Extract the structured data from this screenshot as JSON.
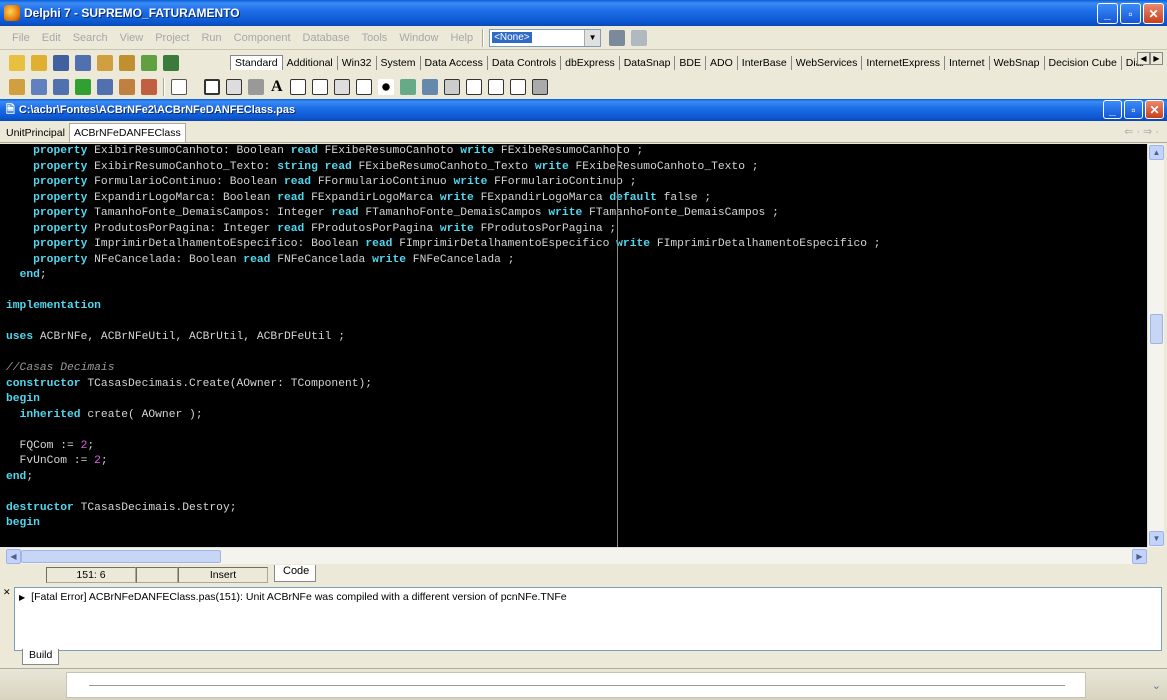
{
  "app": {
    "title": "Delphi 7 - SUPREMO_FATURAMENTO",
    "menu": [
      "File",
      "Edit",
      "Search",
      "View",
      "Project",
      "Run",
      "Component",
      "Database",
      "Tools",
      "Window",
      "Help"
    ],
    "config_combo": "<None>"
  },
  "palette_tabs": [
    "Standard",
    "Additional",
    "Win32",
    "System",
    "Data Access",
    "Data Controls",
    "dbExpress",
    "DataSnap",
    "BDE",
    "ADO",
    "InterBase",
    "WebServices",
    "InternetExpress",
    "Internet",
    "WebSnap",
    "Decision Cube",
    "Dial"
  ],
  "editor": {
    "file_path": "C:\\acbr\\Fontes\\ACBrNFe2\\ACBrNFeDANFEClass.pas",
    "tabs": [
      "UnitPrincipal",
      "ACBrNFeDANFEClass"
    ],
    "nav": "⇐ · ⇒ ·"
  },
  "code_lines": [
    [
      [
        "    ",
        ""
      ],
      [
        "property",
        "kw"
      ],
      [
        " ExibirResumoCanhoto: Boolean ",
        ""
      ],
      [
        "read",
        "kw"
      ],
      [
        " FExibeResumoCanhoto ",
        ""
      ],
      [
        "write",
        "kw"
      ],
      [
        " FExibeResumoCanhoto ;",
        ""
      ]
    ],
    [
      [
        "    ",
        ""
      ],
      [
        "property",
        "kw"
      ],
      [
        " ExibirResumoCanhoto_Texto: ",
        ""
      ],
      [
        "string",
        "kw"
      ],
      [
        " ",
        ""
      ],
      [
        "read",
        "kw"
      ],
      [
        " FExibeResumoCanhoto_Texto ",
        ""
      ],
      [
        "write",
        "kw"
      ],
      [
        " FExibeResumoCanhoto_Texto ;",
        ""
      ]
    ],
    [
      [
        "    ",
        ""
      ],
      [
        "property",
        "kw"
      ],
      [
        " FormularioContinuo: Boolean ",
        ""
      ],
      [
        "read",
        "kw"
      ],
      [
        " FFormularioContinuo ",
        ""
      ],
      [
        "write",
        "kw"
      ],
      [
        " FFormularioContinuo ;",
        ""
      ]
    ],
    [
      [
        "    ",
        ""
      ],
      [
        "property",
        "kw"
      ],
      [
        " ExpandirLogoMarca: Boolean ",
        ""
      ],
      [
        "read",
        "kw"
      ],
      [
        " FExpandirLogoMarca ",
        ""
      ],
      [
        "write",
        "kw"
      ],
      [
        " FExpandirLogoMarca ",
        ""
      ],
      [
        "default",
        "kw"
      ],
      [
        " false ;",
        ""
      ]
    ],
    [
      [
        "    ",
        ""
      ],
      [
        "property",
        "kw"
      ],
      [
        " TamanhoFonte_DemaisCampos: Integer ",
        ""
      ],
      [
        "read",
        "kw"
      ],
      [
        " FTamanhoFonte_DemaisCampos ",
        ""
      ],
      [
        "write",
        "kw"
      ],
      [
        " FTamanhoFonte_DemaisCampos ;",
        ""
      ]
    ],
    [
      [
        "    ",
        ""
      ],
      [
        "property",
        "kw"
      ],
      [
        " ProdutosPorPagina: Integer ",
        ""
      ],
      [
        "read",
        "kw"
      ],
      [
        " FProdutosPorPagina ",
        ""
      ],
      [
        "write",
        "kw"
      ],
      [
        " FProdutosPorPagina ;",
        ""
      ]
    ],
    [
      [
        "    ",
        ""
      ],
      [
        "property",
        "kw"
      ],
      [
        " ImprimirDetalhamentoEspecifico: Boolean ",
        ""
      ],
      [
        "read",
        "kw"
      ],
      [
        " FImprimirDetalhamentoEspecifico ",
        ""
      ],
      [
        "write",
        "kw"
      ],
      [
        " FImprimirDetalhamentoEspecifico ;",
        ""
      ]
    ],
    [
      [
        "    ",
        ""
      ],
      [
        "property",
        "kw"
      ],
      [
        " NFeCancelada: Boolean ",
        ""
      ],
      [
        "read",
        "kw"
      ],
      [
        " FNFeCancelada ",
        ""
      ],
      [
        "write",
        "kw"
      ],
      [
        " FNFeCancelada ;",
        ""
      ]
    ],
    [
      [
        "  ",
        ""
      ],
      [
        "end",
        "kw"
      ],
      [
        ";",
        ""
      ]
    ],
    [
      [
        "",
        ""
      ]
    ],
    [
      [
        "implementation",
        "kw"
      ]
    ],
    [
      [
        "",
        ""
      ]
    ],
    [
      [
        "uses",
        "kw"
      ],
      [
        " ACBrNFe, ACBrNFeUtil, ACBrUtil, ACBrDFeUtil ;",
        ""
      ]
    ],
    [
      [
        "",
        ""
      ]
    ],
    [
      [
        "//Casas Decimais",
        "cm"
      ]
    ],
    [
      [
        "constructor",
        "kw"
      ],
      [
        " TCasasDecimais.Create(AOwner: TComponent);",
        ""
      ]
    ],
    [
      [
        "begin",
        "kw"
      ]
    ],
    [
      [
        "  ",
        ""
      ],
      [
        "inherited",
        "kw"
      ],
      [
        " create( AOwner );",
        ""
      ]
    ],
    [
      [
        "",
        ""
      ]
    ],
    [
      [
        "  FQCom := ",
        ""
      ],
      [
        "2",
        "num"
      ],
      [
        ";",
        ""
      ]
    ],
    [
      [
        "  FvUnCom := ",
        ""
      ],
      [
        "2",
        "num"
      ],
      [
        ";",
        ""
      ]
    ],
    [
      [
        "end",
        "kw"
      ],
      [
        ";",
        ""
      ]
    ],
    [
      [
        "",
        ""
      ]
    ],
    [
      [
        "destructor",
        "kw"
      ],
      [
        " TCasasDecimais.Destroy;",
        ""
      ]
    ],
    [
      [
        "begin",
        "kw"
      ]
    ]
  ],
  "status": {
    "position": "151:  6",
    "mode": "Insert",
    "code_tab": "Code"
  },
  "messages": [
    "[Fatal Error] ACBrNFeDANFEClass.pas(151): Unit ACBrNFe was compiled with a different version of pcnNFe.TNFe"
  ],
  "build_tab": "Build"
}
